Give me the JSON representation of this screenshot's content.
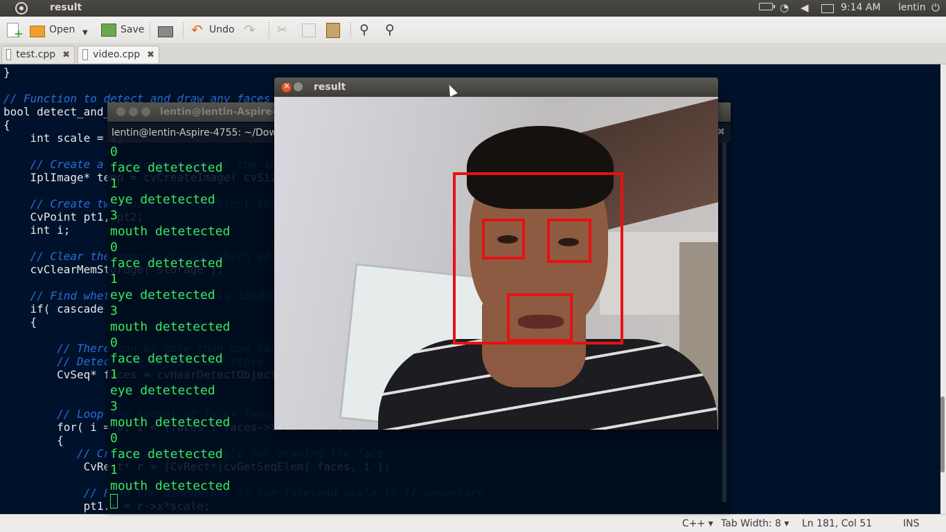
{
  "top_panel": {
    "app_title": "result",
    "clock": "9:14 AM",
    "user": "lentin"
  },
  "toolbar": {
    "open_label": "Open",
    "save_label": "Save",
    "undo_label": "Undo"
  },
  "tabs": [
    {
      "label": "test.cpp",
      "active": false
    },
    {
      "label": "video.cpp",
      "active": true
    }
  ],
  "code_lines": [
    {
      "text": "}",
      "type": "code"
    },
    {
      "text": "",
      "type": "code"
    },
    {
      "text": "// Function to detect and draw any faces that is present in an image",
      "type": "comment"
    },
    {
      "text": "bool detect_and_draw( IplImage* img,CvHaarClassifierCascade* cascade )",
      "type": "code"
    },
    {
      "text": "{",
      "type": "code"
    },
    {
      "text": "    int scale = 1;",
      "type": "code"
    },
    {
      "text": "",
      "type": "code"
    },
    {
      "text": "    // Create a new image based on the input image",
      "type": "comment"
    },
    {
      "text": "    IplImage* temp = cvCreateImage( cvSize(img->width/scale,img->height/scale), 8, 3 );",
      "type": "code"
    },
    {
      "text": "",
      "type": "code"
    },
    {
      "text": "    // Create two points to represent the face locations",
      "type": "comment"
    },
    {
      "text": "    CvPoint pt1, pt2;",
      "type": "code"
    },
    {
      "text": "    int i;",
      "type": "code"
    },
    {
      "text": "",
      "type": "code"
    },
    {
      "text": "    // Clear the memory storage which was used before",
      "type": "comment"
    },
    {
      "text": "    cvClearMemStorage( storage );",
      "type": "code"
    },
    {
      "text": "",
      "type": "code"
    },
    {
      "text": "    // Find whether the cascade is loaded, to find the faces. If yes, then:",
      "type": "comment"
    },
    {
      "text": "    if( cascade )",
      "type": "code"
    },
    {
      "text": "    {",
      "type": "code"
    },
    {
      "text": "",
      "type": "code"
    },
    {
      "text": "        // There can be more than one face in an image. So create a growable sequence of faces.",
      "type": "comment"
    },
    {
      "text": "        // Detect the objects and store them in the sequence",
      "type": "comment"
    },
    {
      "text": "        CvSeq* faces = cvHaarDetectObjects( img, cascade, storage,",
      "type": "code"
    },
    {
      "text": "",
      "type": "code"
    },
    {
      "text": "",
      "type": "code"
    },
    {
      "text": "        // Loop the number of faces found.",
      "type": "comment"
    },
    {
      "text": "        for( i = 0; i < (faces ? faces->total : 0); i++ )",
      "type": "code"
    },
    {
      "text": "        {",
      "type": "code"
    },
    {
      "text": "           // Create a new rectangle for drawing the face",
      "type": "comment"
    },
    {
      "text": "            CvRect* r = (CvRect*)cvGetSeqElem( faces, i );",
      "type": "code"
    },
    {
      "text": "",
      "type": "code"
    },
    {
      "text": "            // Find the dimensions of the face,and scale it if necessary",
      "type": "comment"
    },
    {
      "text": "            pt1.x = r->x*scale;",
      "type": "code"
    }
  ],
  "statusbar": {
    "language": "C++",
    "tab_width": "Tab Width: 8",
    "position": "Ln 181, Col 51",
    "mode": "INS"
  },
  "terminal": {
    "title": "lentin@lentin-Aspire-4755: ~/Downloads",
    "tab_label": "lentin@lentin-Aspire-4755: ~/Down",
    "output": [
      "0",
      "face detetected",
      "1",
      "eye detetected",
      "3",
      "mouth detetected",
      "0",
      "face detetected",
      "1",
      "eye detetected",
      "3",
      "mouth detetected",
      "0",
      "face detetected",
      "1",
      "eye detetected",
      "3",
      "mouth detetected",
      "0",
      "face detetected",
      "1",
      "mouth detetected"
    ]
  },
  "result_window": {
    "title": "result"
  },
  "colors": {
    "detection_box": "#e81111",
    "terminal_text": "#39e85a",
    "code_background": "#00122b",
    "comment": "#2b6ed8"
  }
}
